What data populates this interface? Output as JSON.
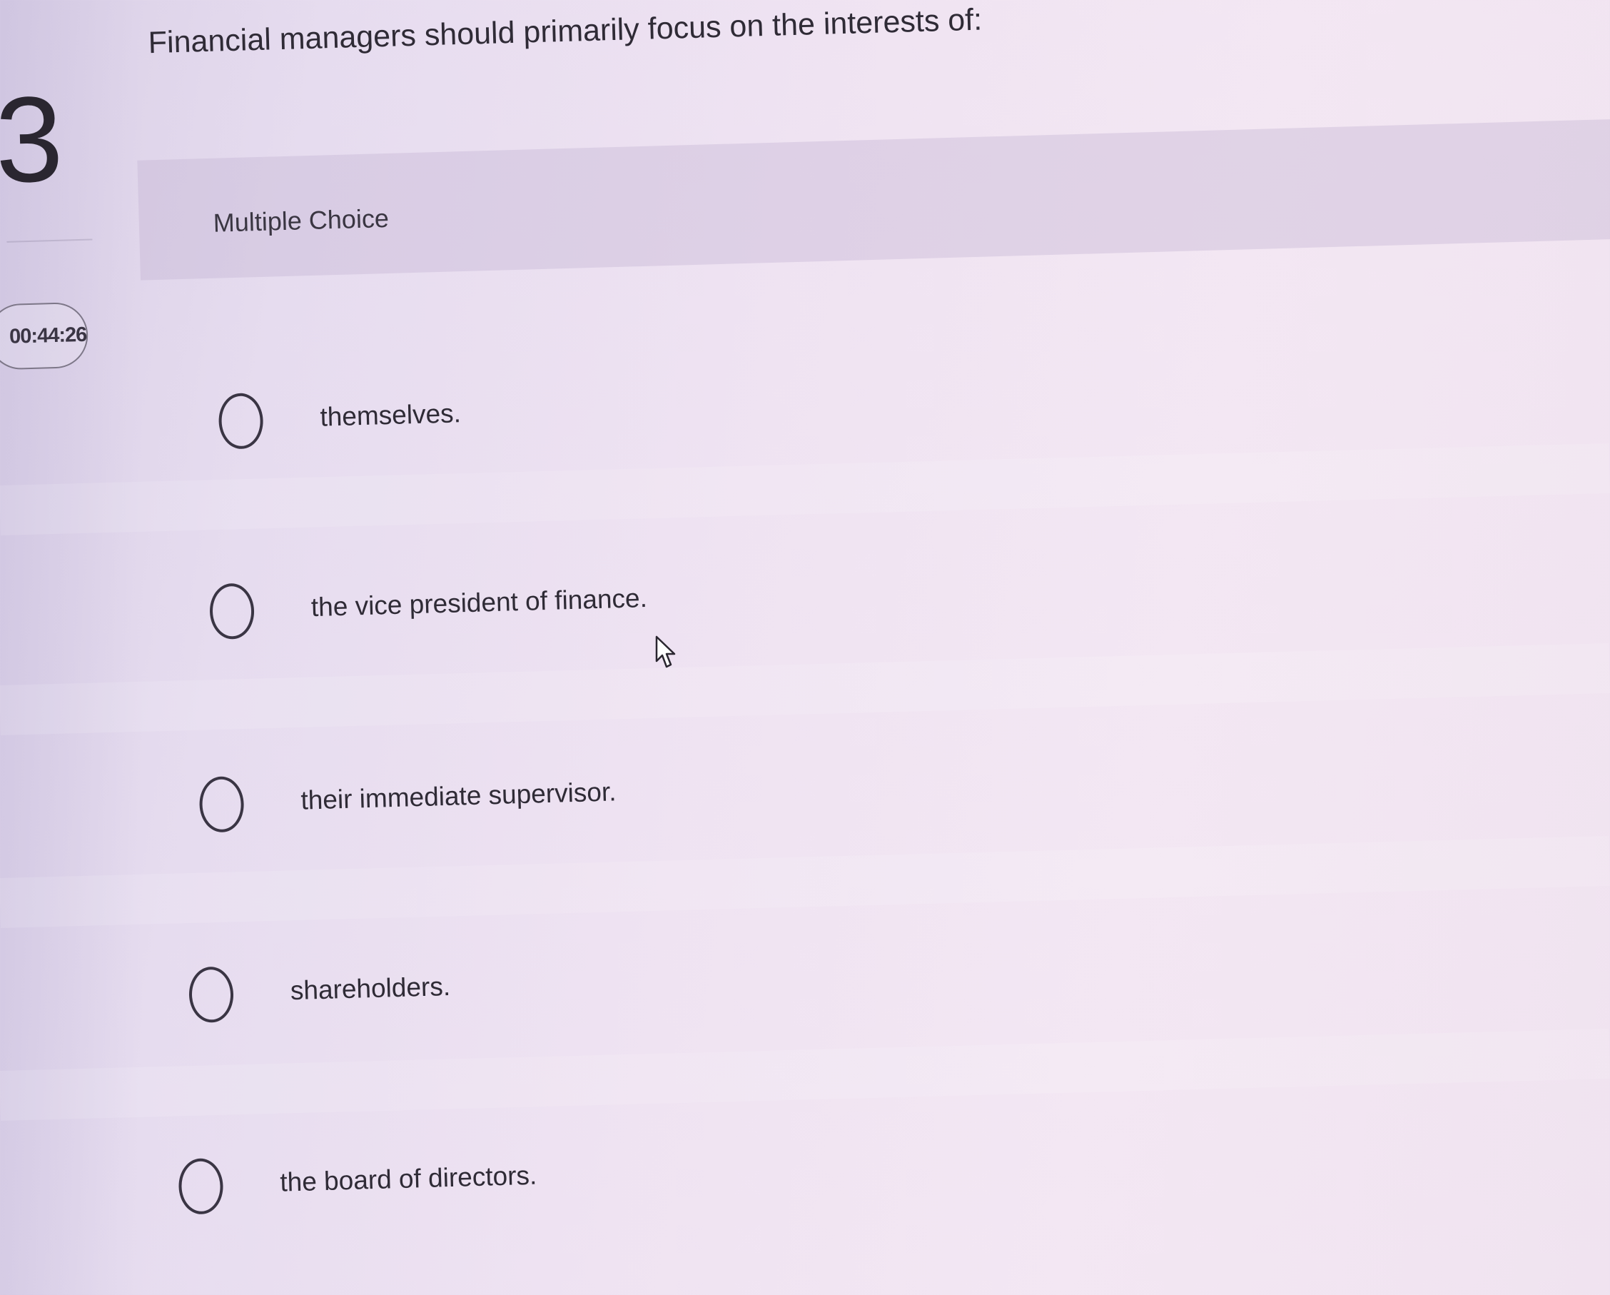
{
  "question": {
    "number": "3",
    "text": "Financial managers should primarily focus on the interests of:",
    "type_label": "Multiple Choice"
  },
  "timer": {
    "value": "00:44:26"
  },
  "options": [
    {
      "label": "themselves."
    },
    {
      "label": "the vice president of finance."
    },
    {
      "label": "their immediate supervisor."
    },
    {
      "label": "shareholders."
    },
    {
      "label": "the board of directors."
    }
  ],
  "icons": {
    "radio": "radio-button-icon",
    "cursor": "mouse-pointer-icon"
  }
}
